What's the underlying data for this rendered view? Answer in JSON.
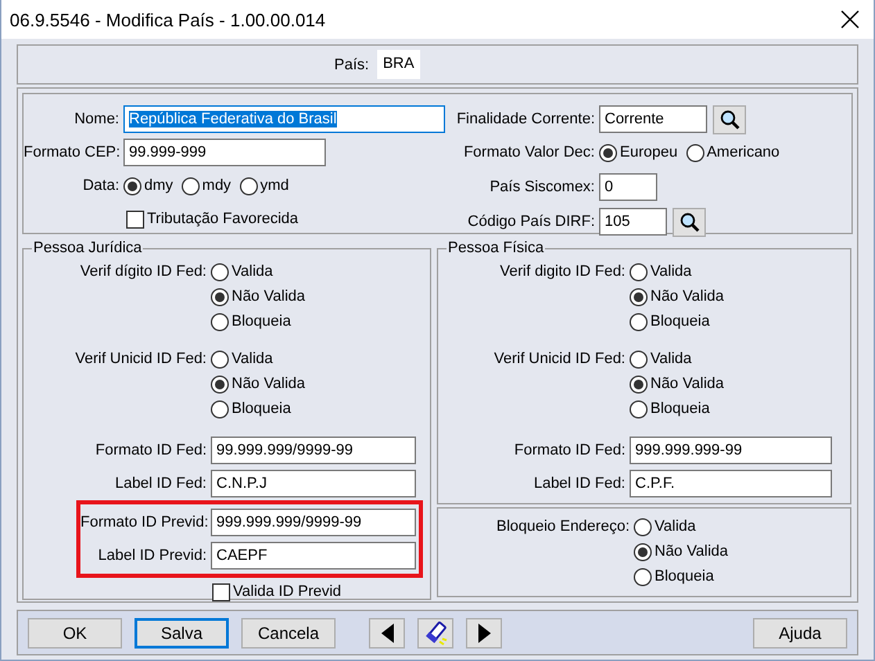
{
  "window": {
    "title": "06.9.5546 - Modifica País - 1.00.00.014"
  },
  "pais": {
    "label": "País:",
    "value": "BRA"
  },
  "general": {
    "left": [
      {
        "kind": "text",
        "label": "Nome:",
        "value": "República Federativa do Brasil",
        "highlighted": true
      },
      {
        "kind": "text",
        "label": "Formato CEP:",
        "value": "99.999-999",
        "highlighted": false
      },
      {
        "kind": "radio",
        "label": "Data:",
        "options": [
          {
            "label": "dmy",
            "selected": true
          },
          {
            "label": "mdy",
            "selected": false
          },
          {
            "label": "ymd",
            "selected": false
          }
        ]
      },
      {
        "kind": "checkbox",
        "label": "Tributação Favorecida",
        "checked": false
      }
    ],
    "right": [
      {
        "kind": "lookup",
        "label": "Finalidade Corrente:",
        "value": "Corrente"
      },
      {
        "kind": "radio",
        "label": "Formato Valor Dec:",
        "options": [
          {
            "label": "Europeu",
            "selected": true
          },
          {
            "label": "Americano",
            "selected": false
          }
        ]
      },
      {
        "kind": "text",
        "label": "País Siscomex:",
        "value": "0",
        "highlighted": false
      },
      {
        "kind": "lookup",
        "label": "Código País DIRF:",
        "value": "105"
      }
    ]
  },
  "pessoa_juridica": {
    "title": "Pessoa Jurídica",
    "rows": [
      {
        "kind": "radio_stack",
        "label": "Verif dígito ID Fed:",
        "options": [
          {
            "label": "Valida",
            "selected": false
          },
          {
            "label": "Não Valida",
            "selected": true
          },
          {
            "label": "Bloqueia",
            "selected": false
          }
        ]
      },
      {
        "kind": "radio_stack",
        "label": "Verif Unicid ID Fed:",
        "options": [
          {
            "label": "Valida",
            "selected": false
          },
          {
            "label": "Não Valida",
            "selected": true
          },
          {
            "label": "Bloqueia",
            "selected": false
          }
        ]
      },
      {
        "kind": "text",
        "label": "Formato ID Fed:",
        "value": "99.999.999/9999-99",
        "annotated": false
      },
      {
        "kind": "text",
        "label": "Label ID Fed:",
        "value": "C.N.P.J",
        "annotated": false
      },
      {
        "kind": "text",
        "label": "Formato ID Previd:",
        "value": "999.999.999/9999-99",
        "annotated": true
      },
      {
        "kind": "text",
        "label": "Label ID Previd:",
        "value": "CAEPF",
        "annotated": true
      },
      {
        "kind": "checkbox",
        "label": "Valida ID Previd",
        "checked": false
      }
    ]
  },
  "pessoa_fisica": {
    "title": "Pessoa Física",
    "rows": [
      {
        "kind": "radio_stack",
        "label": "Verif digito ID Fed:",
        "options": [
          {
            "label": "Valida",
            "selected": false
          },
          {
            "label": "Não Valida",
            "selected": true
          },
          {
            "label": "Bloqueia",
            "selected": false
          }
        ]
      },
      {
        "kind": "radio_stack",
        "label": "Verif Unicid ID Fed:",
        "options": [
          {
            "label": "Valida",
            "selected": false
          },
          {
            "label": "Não Valida",
            "selected": true
          },
          {
            "label": "Bloqueia",
            "selected": false
          }
        ]
      },
      {
        "kind": "text",
        "label": "Formato ID Fed:",
        "value": "999.999.999-99",
        "annotated": false
      },
      {
        "kind": "text",
        "label": "Label ID Fed:",
        "value": "C.P.F.",
        "annotated": false
      }
    ]
  },
  "bloqueio": {
    "label": "Bloqueio Endereço:",
    "options": [
      {
        "label": "Valida",
        "selected": false
      },
      {
        "label": "Não Valida",
        "selected": true
      },
      {
        "label": "Bloqueia",
        "selected": false
      }
    ]
  },
  "buttons": [
    {
      "kind": "text",
      "label": "OK",
      "focused": false
    },
    {
      "kind": "text",
      "label": "Salva",
      "focused": true
    },
    {
      "kind": "text",
      "label": "Cancela",
      "focused": false
    },
    {
      "kind": "prev"
    },
    {
      "kind": "find"
    },
    {
      "kind": "next"
    },
    {
      "kind": "help",
      "label": "Ajuda",
      "focused": false
    }
  ]
}
